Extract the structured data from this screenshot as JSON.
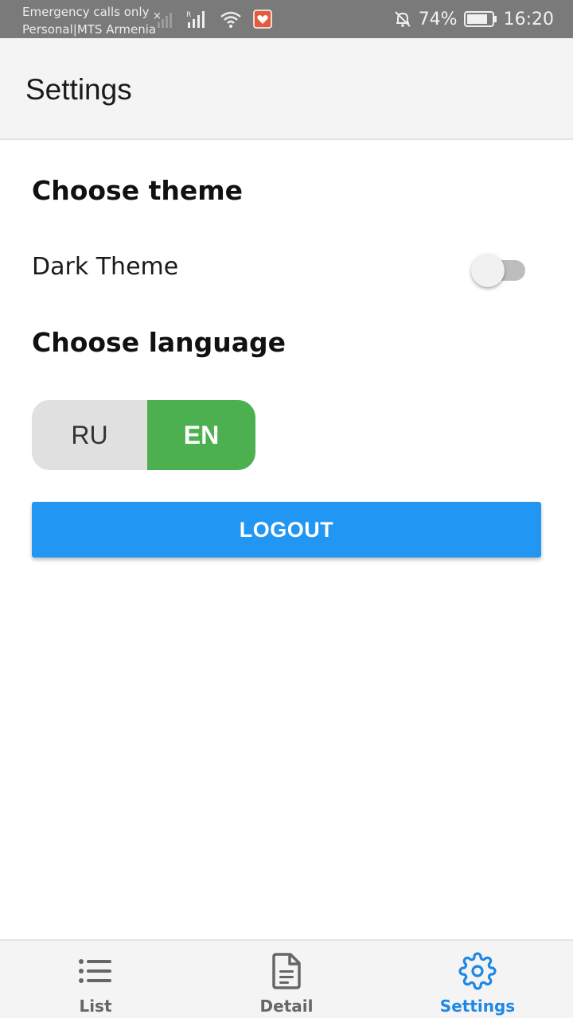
{
  "status_bar": {
    "carrier_line1": "Emergency calls only",
    "carrier_line2": "Personal|MTS Armenia",
    "battery": "74%",
    "time": "16:20"
  },
  "app_bar": {
    "title": "Settings"
  },
  "theme_section": {
    "heading": "Choose theme",
    "dark_theme_label": "Dark Theme",
    "dark_theme_enabled": false
  },
  "language_section": {
    "heading": "Choose language",
    "options": [
      "RU",
      "EN"
    ],
    "selected": "EN"
  },
  "logout_label": "LOGOUT",
  "bottom_nav": {
    "items": [
      {
        "label": "List",
        "icon": "list-icon",
        "active": false
      },
      {
        "label": "Detail",
        "icon": "document-icon",
        "active": false
      },
      {
        "label": "Settings",
        "icon": "gear-icon",
        "active": true
      }
    ]
  },
  "colors": {
    "status_bar": "#7a7a7a",
    "app_bar": "#f4f4f4",
    "accent_blue": "#2196f3",
    "active_nav": "#1e88e5",
    "selected_language": "#4caf50",
    "unselected_language": "#e0e0e0"
  }
}
